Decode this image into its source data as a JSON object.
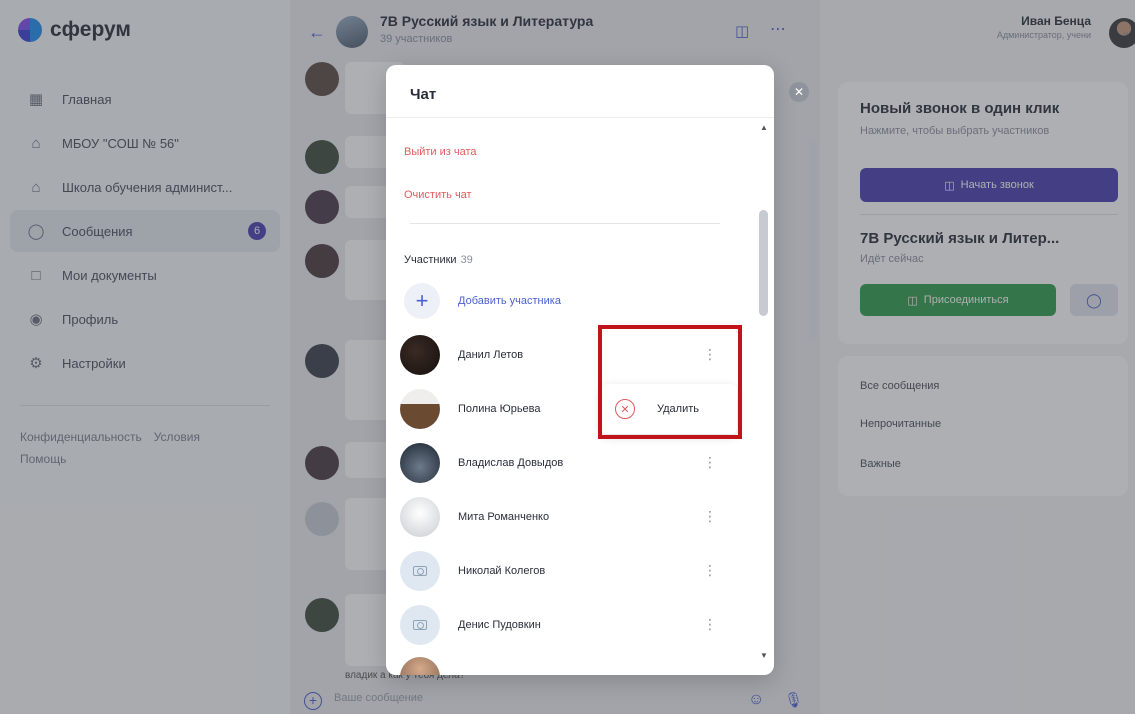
{
  "app": {
    "logo_text": "сферум"
  },
  "sidebar": {
    "items": [
      {
        "label": "Главная",
        "icon": "home-grid-icon"
      },
      {
        "label": "МБОУ \"СОШ № 56\"",
        "icon": "school-icon"
      },
      {
        "label": "Школа обучения админист...",
        "icon": "school-icon"
      },
      {
        "label": "Сообщения",
        "icon": "chat-bubble-icon",
        "active": true,
        "badge": "6"
      },
      {
        "label": "Мои документы",
        "icon": "document-icon"
      },
      {
        "label": "Профиль",
        "icon": "profile-icon"
      },
      {
        "label": "Настройки",
        "icon": "gear-icon"
      }
    ],
    "links": [
      "Конфиденциальность",
      "Условия",
      "Помощь"
    ]
  },
  "chat": {
    "title": "7В Русский язык и Литература",
    "subtitle": "39 участников",
    "composer_placeholder": "Ваше сообщение",
    "bg_last_line": "владик а как у тебя дела?"
  },
  "user": {
    "name": "Иван Бенца",
    "role": "Администратор, учени"
  },
  "right": {
    "call_card": {
      "title": "Новый звонок в один клик",
      "subtitle": "Нажмите, чтобы выбрать участников",
      "start_button": "Начать звонок"
    },
    "active_call": {
      "title": "7В Русский язык и Литер...",
      "status": "Идёт сейчас",
      "join_button": "Присоединиться"
    },
    "filters": [
      "Все сообщения",
      "Непрочитанные",
      "Важные"
    ]
  },
  "modal": {
    "title": "Чат",
    "leave_link": "Выйти из чата",
    "clear_link": "Очистить чат",
    "members_label": "Участники",
    "members_count": "39",
    "add_member": "Добавить участника",
    "members": [
      {
        "name": "Данил Летов"
      },
      {
        "name": "Полина Юрьева"
      },
      {
        "name": "Владислав Довыдов"
      },
      {
        "name": "Мита Романченко"
      },
      {
        "name": "Николай Колегов"
      },
      {
        "name": "Денис Пудовкин"
      }
    ]
  },
  "context_menu": {
    "delete_label": "Удалить"
  },
  "colors": {
    "accent": "#4a3fb0",
    "join_green": "#2f9d4a",
    "danger": "#e05b5b",
    "highlight": "#c0141a"
  }
}
